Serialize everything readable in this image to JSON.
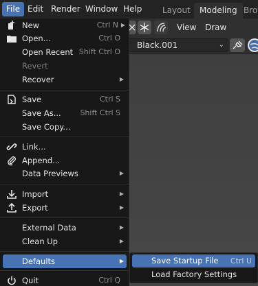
{
  "topbar": {
    "menus": [
      "File",
      "Edit",
      "Render",
      "Window",
      "Help"
    ],
    "workspaces": [
      "Layout",
      "Modeling",
      "Brow"
    ]
  },
  "editor_header": {
    "menus": [
      "View",
      "Draw"
    ]
  },
  "material": {
    "name": "Black.001"
  },
  "file_menu": {
    "new": {
      "label": "New",
      "shortcut": "Ctrl N"
    },
    "open": {
      "label": "Open...",
      "shortcut": "Ctrl O"
    },
    "open_recent": {
      "label": "Open Recent",
      "shortcut": "Shift Ctrl O"
    },
    "revert": {
      "label": "Revert"
    },
    "recover": {
      "label": "Recover"
    },
    "save": {
      "label": "Save",
      "shortcut": "Ctrl S"
    },
    "save_as": {
      "label": "Save As...",
      "shortcut": "Shift Ctrl S"
    },
    "save_copy": {
      "label": "Save Copy..."
    },
    "link": {
      "label": "Link..."
    },
    "append": {
      "label": "Append..."
    },
    "data_previews": {
      "label": "Data Previews"
    },
    "import": {
      "label": "Import"
    },
    "export": {
      "label": "Export"
    },
    "external_data": {
      "label": "External Data"
    },
    "clean_up": {
      "label": "Clean Up"
    },
    "defaults": {
      "label": "Defaults"
    },
    "quit": {
      "label": "Quit",
      "shortcut": "Ctrl Q"
    }
  },
  "defaults_submenu": {
    "save_startup": {
      "label": "Save Startup File",
      "shortcut": "Ctrl U"
    },
    "load_factory": {
      "label": "Load Factory Settings"
    }
  },
  "colors": {
    "accent": "#4772b3",
    "menu_bg": "#181818",
    "viewport": "#404040"
  }
}
